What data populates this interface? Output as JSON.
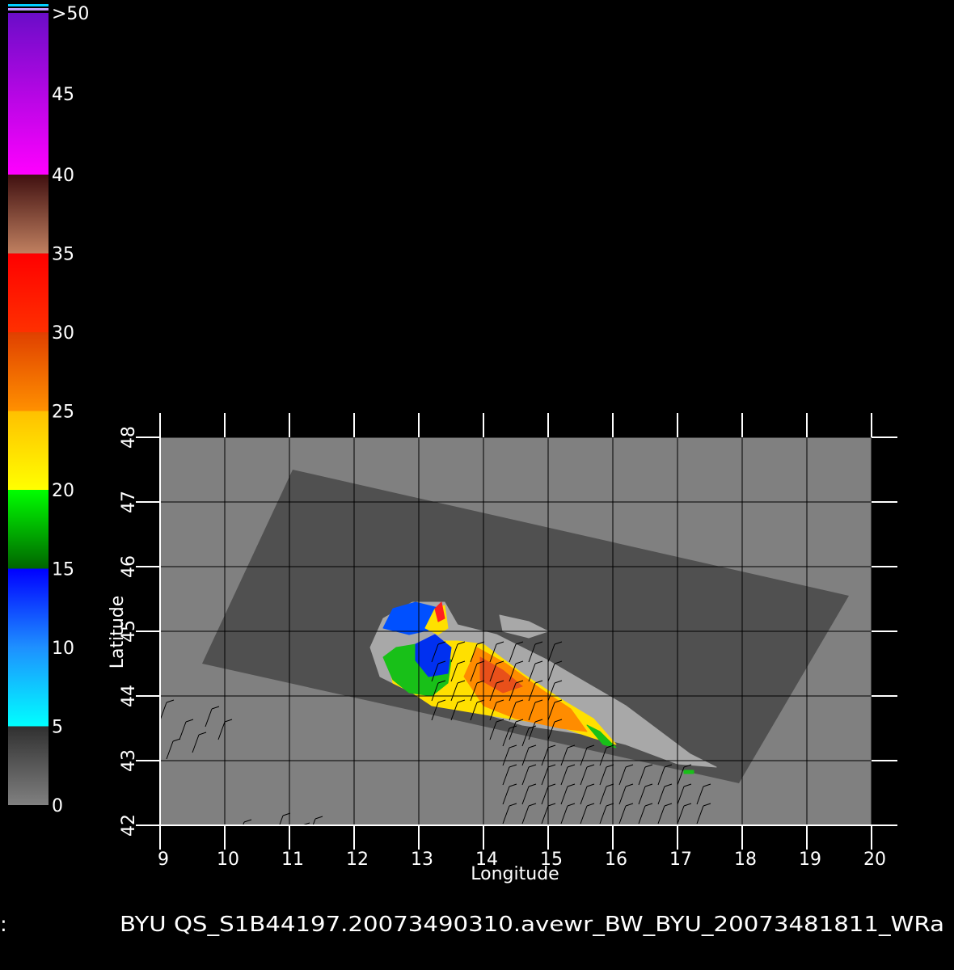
{
  "chart_data": {
    "type": "heatmap",
    "xlabel": "Longitude",
    "ylabel": "Latitude",
    "xlim": [
      9,
      20
    ],
    "ylim": [
      42,
      48
    ],
    "x_ticks": [
      "9",
      "10",
      "11",
      "12",
      "13",
      "14",
      "15",
      "16",
      "17",
      "18",
      "19",
      "20"
    ],
    "y_ticks": [
      "42",
      "43",
      "44",
      "45",
      "46",
      "47",
      "48"
    ],
    "grid": true,
    "footer": "BYU  QS_S1B44197.20073490310.avewr_BW_BYU_20073481811_WRa",
    "footer_left_mark": ":",
    "colorbar": {
      "position": "left",
      "labels": [
        {
          "text": "0",
          "value": 0
        },
        {
          "text": "5",
          "value": 5
        },
        {
          "text": "10",
          "value": 10
        },
        {
          "text": "15",
          "value": 15
        },
        {
          "text": "20",
          "value": 20
        },
        {
          "text": "25",
          "value": 25
        },
        {
          "text": "30",
          "value": 30
        },
        {
          "text": "35",
          "value": 35
        },
        {
          "text": "40",
          "value": 40
        },
        {
          "text": "45",
          "value": 45
        },
        {
          "text": ">50",
          "value": 50
        }
      ],
      "bands": [
        {
          "from": 0,
          "to": 5,
          "colors": [
            "#808080",
            "#303030"
          ]
        },
        {
          "from": 5,
          "to": 10,
          "colors": [
            "#00ffff",
            "#1e90ff"
          ]
        },
        {
          "from": 10,
          "to": 15,
          "colors": [
            "#1e90ff",
            "#0000ff"
          ]
        },
        {
          "from": 15,
          "to": 20,
          "colors": [
            "#006400",
            "#00ff00"
          ]
        },
        {
          "from": 20,
          "to": 25,
          "colors": [
            "#ffff00",
            "#ffc000"
          ]
        },
        {
          "from": 25,
          "to": 30,
          "colors": [
            "#ff9000",
            "#e04000"
          ]
        },
        {
          "from": 30,
          "to": 35,
          "colors": [
            "#ff3000",
            "#ff0000"
          ]
        },
        {
          "from": 35,
          "to": 40,
          "colors": [
            "#c08060",
            "#401010"
          ]
        },
        {
          "from": 40,
          "to": 50,
          "colors": [
            "#ff00ff",
            "#6a0dc8"
          ]
        }
      ]
    },
    "swath_corners": [
      [
        11.05,
        47.5
      ],
      [
        19.65,
        45.55
      ],
      [
        17.95,
        42.65
      ],
      [
        9.65,
        44.5
      ]
    ],
    "colors": {
      "background": "#000000",
      "land": "#808080",
      "swath": "#505050",
      "grid": "#000000",
      "frame": "#ffffff"
    },
    "wind_regions": [
      {
        "value": 1,
        "color": "#a8a8a8",
        "points": [
          [
            12.45,
            45.2
          ],
          [
            12.9,
            45.45
          ],
          [
            13.4,
            45.45
          ],
          [
            13.6,
            45.1
          ],
          [
            14.2,
            44.95
          ],
          [
            15.0,
            44.55
          ],
          [
            15.6,
            44.2
          ],
          [
            16.2,
            43.85
          ],
          [
            17.2,
            43.1
          ],
          [
            17.6,
            42.9
          ],
          [
            17.0,
            42.95
          ],
          [
            16.2,
            43.25
          ],
          [
            15.6,
            43.4
          ],
          [
            14.6,
            43.55
          ],
          [
            13.6,
            43.85
          ],
          [
            12.9,
            44.05
          ],
          [
            12.4,
            44.3
          ],
          [
            12.25,
            44.75
          ]
        ]
      },
      {
        "value": 1,
        "color": "#a8a8a8",
        "points": [
          [
            14.25,
            45.25
          ],
          [
            14.7,
            45.15
          ],
          [
            15.0,
            45.0
          ],
          [
            14.7,
            44.9
          ],
          [
            14.3,
            45.0
          ]
        ]
      },
      {
        "value": 22,
        "color": "#ffe000",
        "points": [
          [
            12.55,
            44.45
          ],
          [
            12.85,
            44.75
          ],
          [
            13.2,
            44.85
          ],
          [
            13.6,
            44.85
          ],
          [
            14.0,
            44.8
          ],
          [
            14.6,
            44.35
          ],
          [
            15.2,
            43.95
          ],
          [
            15.7,
            43.65
          ],
          [
            16.05,
            43.25
          ],
          [
            15.7,
            43.35
          ],
          [
            15.1,
            43.55
          ],
          [
            14.4,
            43.65
          ],
          [
            13.8,
            43.75
          ],
          [
            13.2,
            43.85
          ],
          [
            12.9,
            44.05
          ],
          [
            12.6,
            44.2
          ]
        ]
      },
      {
        "value": 27,
        "color": "#ff8c00",
        "points": [
          [
            13.9,
            44.75
          ],
          [
            14.35,
            44.5
          ],
          [
            14.9,
            44.1
          ],
          [
            15.35,
            43.8
          ],
          [
            15.6,
            43.45
          ],
          [
            15.2,
            43.5
          ],
          [
            14.5,
            43.65
          ],
          [
            14.0,
            43.85
          ],
          [
            13.7,
            44.3
          ]
        ]
      },
      {
        "value": 30,
        "color": "#e8501a",
        "points": [
          [
            13.95,
            44.6
          ],
          [
            14.3,
            44.4
          ],
          [
            14.6,
            44.15
          ],
          [
            14.3,
            44.05
          ],
          [
            13.95,
            44.25
          ]
        ]
      },
      {
        "value": 17,
        "color": "#18c018",
        "points": [
          [
            12.45,
            44.6
          ],
          [
            12.65,
            44.75
          ],
          [
            12.95,
            44.8
          ],
          [
            13.3,
            44.8
          ],
          [
            13.5,
            44.55
          ],
          [
            13.45,
            44.2
          ],
          [
            13.2,
            44.0
          ],
          [
            12.85,
            44.05
          ],
          [
            12.6,
            44.25
          ]
        ]
      },
      {
        "value": 13,
        "color": "#0050ff",
        "points": [
          [
            12.45,
            45.05
          ],
          [
            12.6,
            45.35
          ],
          [
            12.95,
            45.45
          ],
          [
            13.35,
            45.35
          ],
          [
            13.3,
            45.05
          ],
          [
            12.85,
            44.95
          ]
        ]
      },
      {
        "value": 13,
        "color": "#0030f0",
        "points": [
          [
            12.95,
            44.8
          ],
          [
            13.25,
            44.95
          ],
          [
            13.5,
            44.75
          ],
          [
            13.45,
            44.35
          ],
          [
            13.15,
            44.3
          ],
          [
            12.95,
            44.55
          ]
        ]
      },
      {
        "value": 22,
        "color": "#ffe000",
        "points": [
          [
            13.1,
            45.05
          ],
          [
            13.25,
            45.35
          ],
          [
            13.4,
            45.4
          ],
          [
            13.45,
            45.05
          ],
          [
            13.3,
            44.95
          ]
        ]
      },
      {
        "value": 32,
        "color": "#ff2020",
        "points": [
          [
            13.25,
            45.35
          ],
          [
            13.35,
            45.45
          ],
          [
            13.4,
            45.2
          ],
          [
            13.3,
            45.15
          ]
        ]
      },
      {
        "value": 17,
        "color": "#18c018",
        "points": [
          [
            15.6,
            43.55
          ],
          [
            15.8,
            43.45
          ],
          [
            16.05,
            43.2
          ],
          [
            15.85,
            43.25
          ]
        ]
      },
      {
        "value": 17,
        "color": "#18c018",
        "points": [
          [
            17.1,
            42.85
          ],
          [
            17.25,
            42.85
          ],
          [
            17.25,
            42.8
          ],
          [
            17.1,
            42.8
          ]
        ]
      }
    ]
  }
}
